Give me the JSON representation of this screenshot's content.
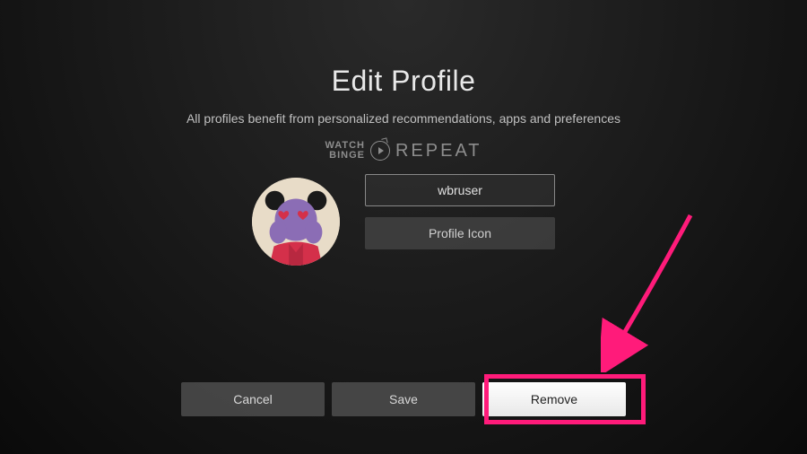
{
  "title": "Edit Profile",
  "subtitle": "All profiles benefit from personalized recommendations, apps and preferences",
  "watermark": {
    "watch": "WATCH",
    "binge": "BINGE",
    "repeat": "REPEAT"
  },
  "profile": {
    "name": "wbruser",
    "icon_button": "Profile Icon"
  },
  "buttons": {
    "cancel": "Cancel",
    "save": "Save",
    "remove": "Remove"
  },
  "colors": {
    "highlight": "#ff1b7a"
  }
}
